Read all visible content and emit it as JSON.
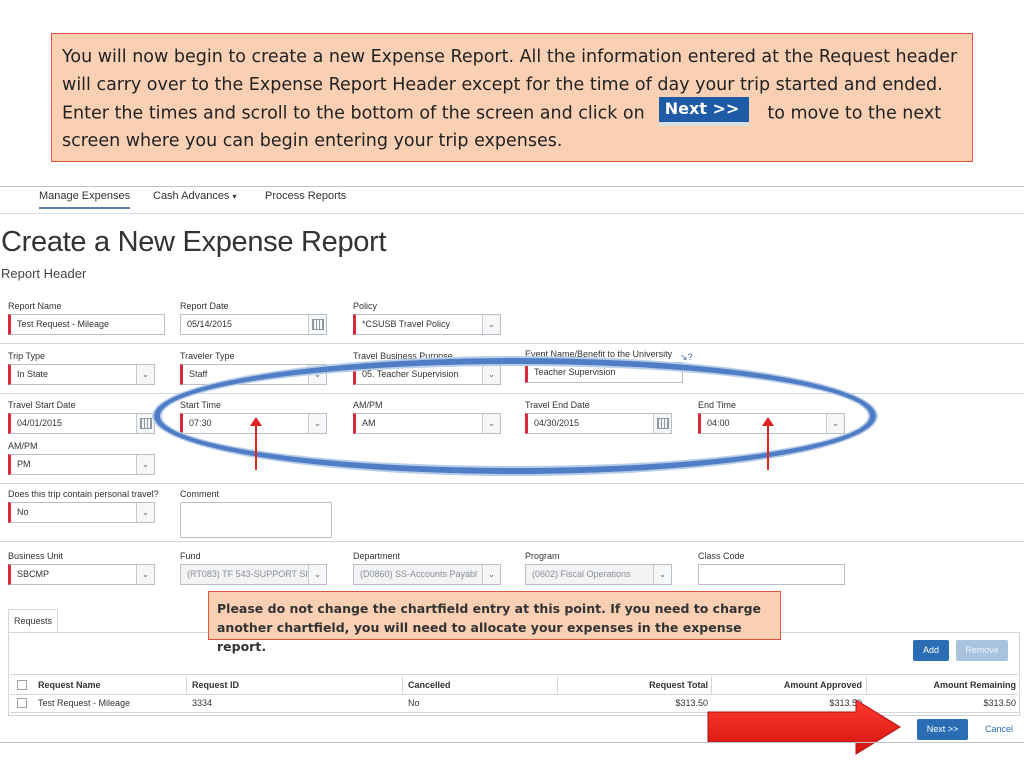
{
  "callout_top": {
    "text_before": "You will now begin to create a new Expense Report.  All the information entered at the Request header will carry over to the Expense Report Header except for the time of day your trip started and ended.  Enter the times and scroll to the bottom of the screen and click on",
    "button_image_label": "Next >>",
    "text_after": "to move to the next screen where you can begin entering your trip expenses."
  },
  "nav": {
    "items": [
      "Manage Expenses",
      "Cash Advances",
      "Process Reports"
    ],
    "caret": "▾"
  },
  "page": {
    "title": "Create a New Expense Report",
    "subtitle": "Report Header"
  },
  "form": {
    "report_name": {
      "label": "Report Name",
      "value": "Test Request - Mileage"
    },
    "report_date": {
      "label": "Report Date",
      "value": "05/14/2015"
    },
    "policy": {
      "label": "Policy",
      "value": "*CSUSB Travel Policy"
    },
    "trip_type": {
      "label": "Trip Type",
      "value": "In State"
    },
    "traveler_type": {
      "label": "Traveler Type",
      "value": "Staff"
    },
    "travel_business_purpose": {
      "label": "Travel Business Purpose",
      "value": "05. Teacher Supervision"
    },
    "event_name": {
      "label": "Event Name/Benefit to the University",
      "value": "Teacher Supervision"
    },
    "travel_start_date": {
      "label": "Travel Start Date",
      "value": "04/01/2015"
    },
    "start_time": {
      "label": "Start Time",
      "value": "07:30"
    },
    "start_ampm": {
      "label": "AM/PM",
      "value": "AM"
    },
    "travel_end_date": {
      "label": "Travel End Date",
      "value": "04/30/2015"
    },
    "end_time": {
      "label": "End Time",
      "value": "04:00"
    },
    "end_ampm": {
      "label": "AM/PM",
      "value": "PM"
    },
    "personal_travel": {
      "label": "Does this trip contain personal travel?",
      "value": "No"
    },
    "comment": {
      "label": "Comment",
      "value": ""
    },
    "business_unit": {
      "label": "Business Unit",
      "value": "SBCMP"
    },
    "fund": {
      "label": "Fund",
      "value": "(RT083) TF 543-SUPPORT SI"
    },
    "department": {
      "label": "Department",
      "value": "(D0860) SS-Accounts Payabl"
    },
    "program": {
      "label": "Program",
      "value": "(0602) Fiscal Operations"
    },
    "class_code": {
      "label": "Class Code",
      "value": ""
    }
  },
  "callout_mid": {
    "text": "Please do not change the chartfield entry at this point.  If you need to charge another chartfield, you will need to allocate your expenses in the expense report."
  },
  "requests": {
    "tab_label": "Requests",
    "add_label": "Add",
    "remove_label": "Remove",
    "columns": [
      "Request Name",
      "Request ID",
      "Cancelled",
      "Request Total",
      "Amount Approved",
      "Amount Remaining"
    ],
    "rows": [
      {
        "name": "Test Request - Mileage",
        "id": "3334",
        "cancelled": "No",
        "total": "$313.50",
        "approved": "$313.50",
        "remaining": "$313.50"
      }
    ]
  },
  "footer": {
    "next_label": "Next >>",
    "cancel_label": "Cancel"
  },
  "colors": {
    "callout_bg": "#fad0b5",
    "callout_border": "#e0553f",
    "primary_button": "#2a6db5",
    "required_marker": "#d42a3c",
    "ellipse": "#4f7dc6",
    "arrow": "#e0251f"
  }
}
